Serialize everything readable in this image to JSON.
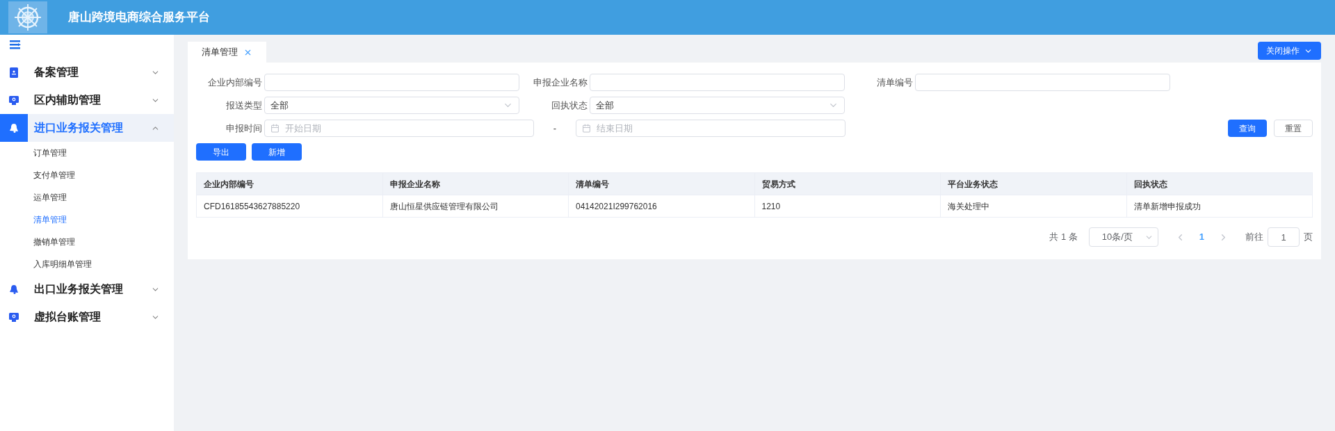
{
  "header": {
    "title": "唐山跨境电商综合服务平台"
  },
  "sidebar": {
    "items": [
      {
        "label": "备案管理",
        "expanded": false,
        "selected": false
      },
      {
        "label": "区内辅助管理",
        "expanded": false,
        "selected": false
      },
      {
        "label": "进口业务报关管理",
        "expanded": true,
        "selected": true,
        "children": [
          {
            "label": "订单管理",
            "selected": false
          },
          {
            "label": "支付单管理",
            "selected": false
          },
          {
            "label": "运单管理",
            "selected": false
          },
          {
            "label": "清单管理",
            "selected": true
          },
          {
            "label": "撤销单管理",
            "selected": false
          },
          {
            "label": "入库明细单管理",
            "selected": false
          }
        ]
      },
      {
        "label": "出口业务报关管理",
        "expanded": false,
        "selected": false
      },
      {
        "label": "虚拟台账管理",
        "expanded": false,
        "selected": false
      }
    ]
  },
  "tabs": [
    {
      "label": "清单管理",
      "selected": true
    }
  ],
  "close_menu": {
    "label": "关闭操作"
  },
  "filter_rows": [
    [
      {
        "label": "企业内部编号",
        "kind": "text"
      },
      {
        "label": "申报企业名称",
        "kind": "text"
      },
      {
        "label": "清单编号",
        "kind": "text"
      }
    ],
    [
      {
        "label": "报送类型",
        "kind": "select",
        "value": "全部"
      },
      {
        "label": "回执状态",
        "kind": "select",
        "value": "全部"
      }
    ],
    [
      {
        "label": "申报时间",
        "kind": "date_range",
        "start_placeholder": "开始日期",
        "separator": "-",
        "end_placeholder": "结束日期"
      }
    ]
  ],
  "search_buttons": [
    {
      "label": "查询",
      "kind": "primary"
    },
    {
      "label": "重置",
      "kind": "plain"
    }
  ],
  "actions": [
    "导出",
    "新增"
  ],
  "table": {
    "columns": [
      "企业内部编号",
      "申报企业名称",
      "清单编号",
      "贸易方式",
      "平台业务状态",
      "回执状态"
    ],
    "rows": [
      [
        "CFD16185543627885220",
        "唐山恒星供应链管理有限公司",
        "04142021I299762016",
        "1210",
        "海关处理中",
        "清单新增申报成功"
      ]
    ]
  },
  "pagination": {
    "total": "共 1 条",
    "page_size": "10条/页",
    "pages": [
      {
        "label": "1",
        "selected": true
      }
    ],
    "goto_label": "前往",
    "goto_value": "1",
    "goto_suffix": "页"
  }
}
